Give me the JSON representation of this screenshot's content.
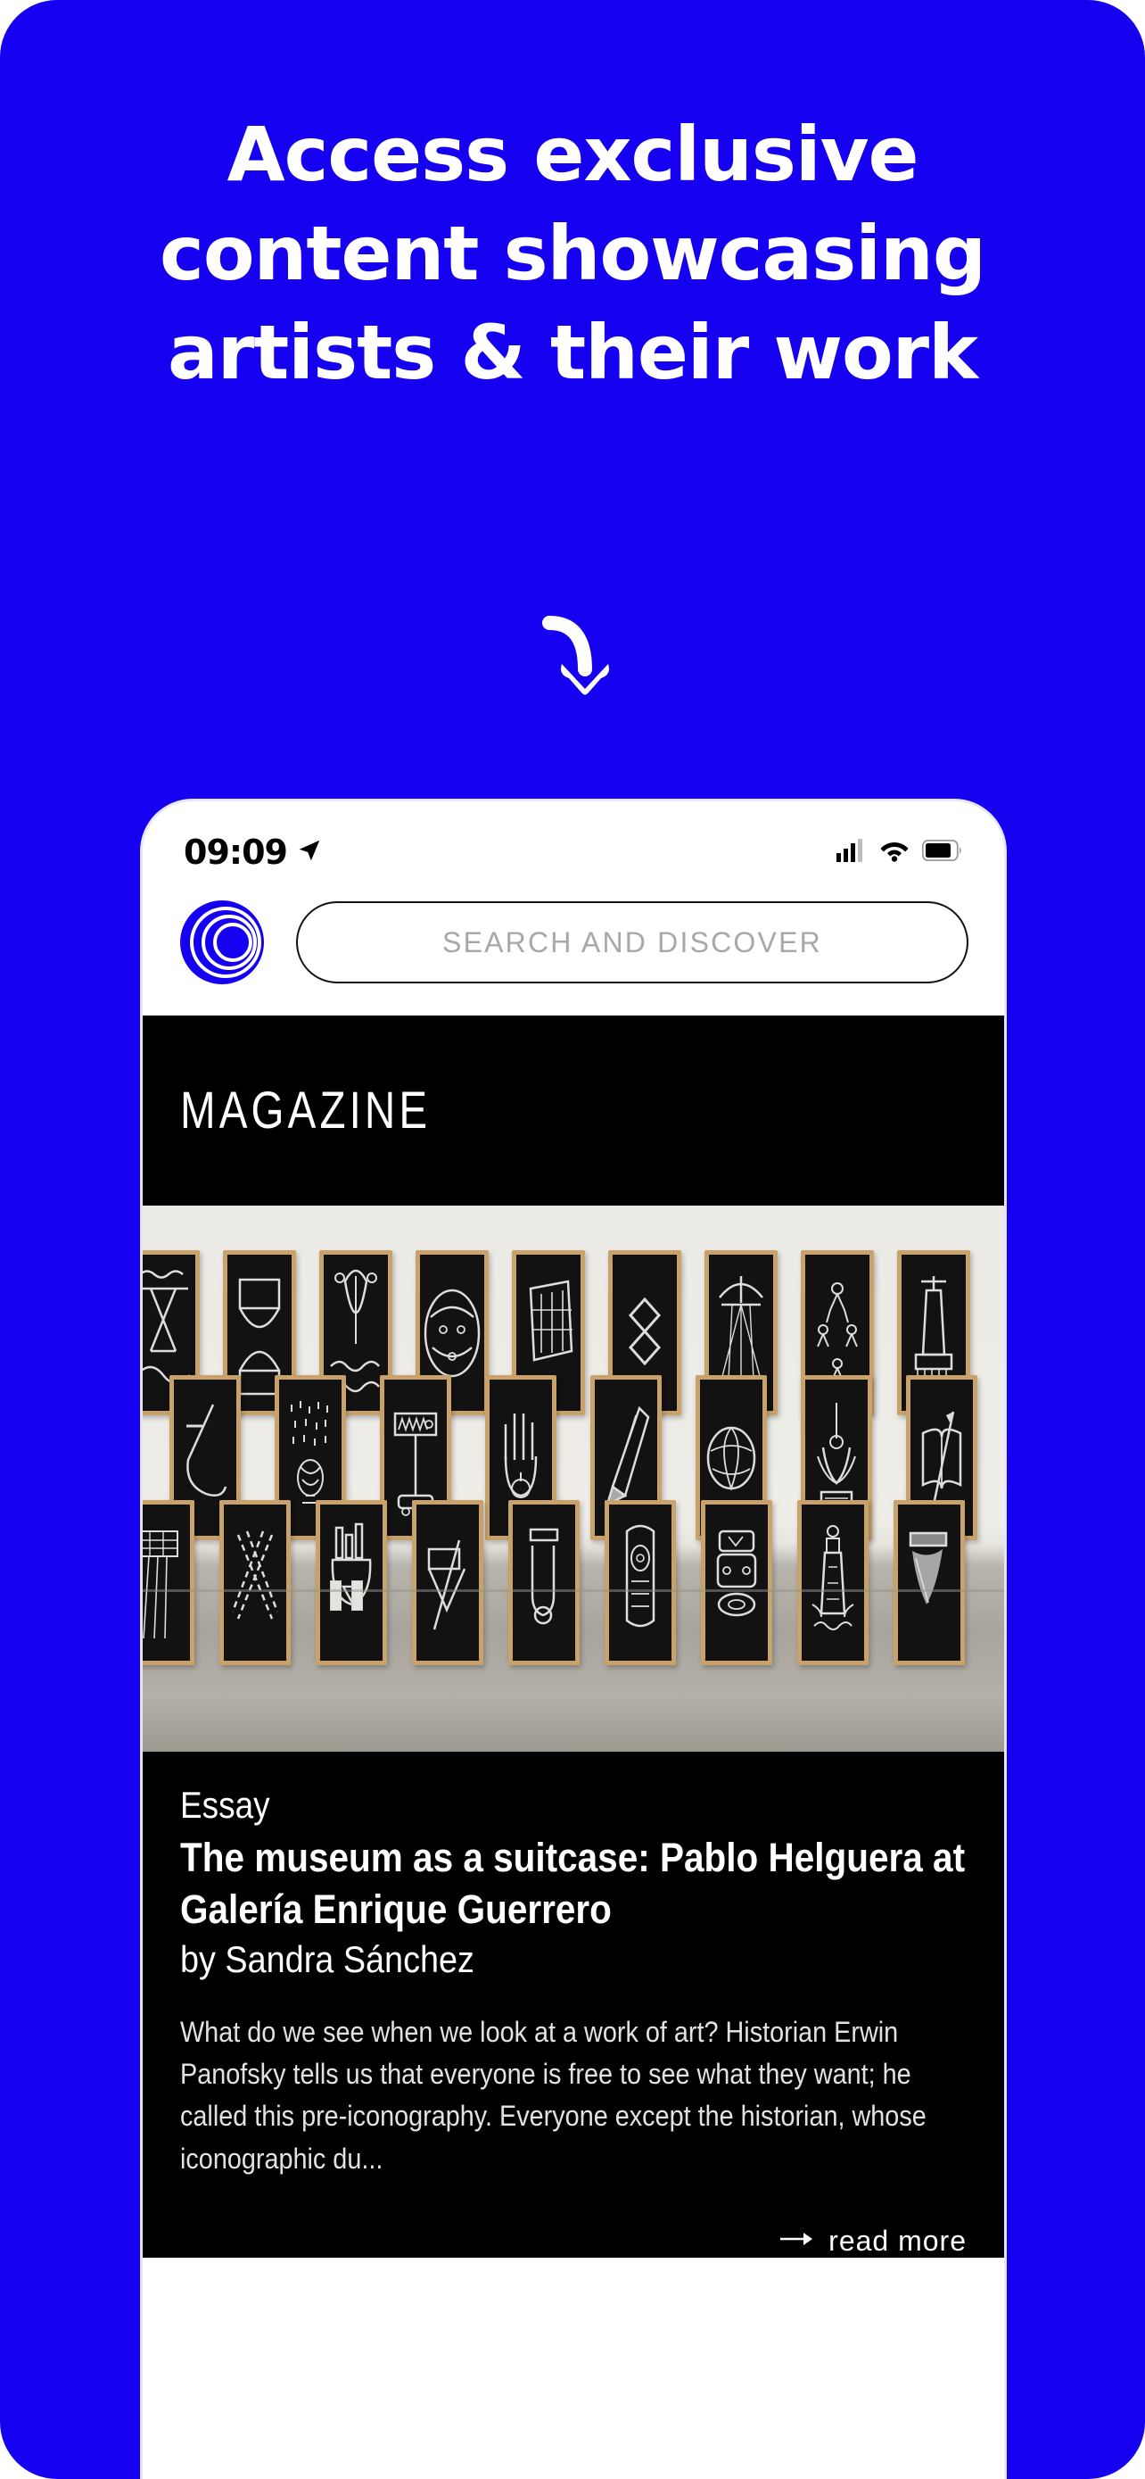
{
  "promo": {
    "background_color": "#1500F0",
    "headline_lines": [
      "Access exclusive",
      "content showcasing",
      "artists & their work"
    ],
    "arrow_icon": "curved-down-arrow-icon"
  },
  "phone": {
    "status_bar": {
      "time": "09:09",
      "location_icon": "location-arrow-icon",
      "signal_icon": "cellular-signal-icon",
      "wifi_icon": "wifi-icon",
      "battery_icon": "battery-full-icon"
    },
    "app_header": {
      "logo_icon": "concentric-circles-logo",
      "logo_color": "#1500F0",
      "search_placeholder": "SEARCH AND DISCOVER",
      "search_value": ""
    },
    "banner": {
      "title": "MAGAZINE",
      "background_color": "#000000",
      "text_color": "#FFFFFF"
    },
    "hero_image": {
      "alt": "gallery-wall-with-framed-chalk-drawings",
      "rows": 3,
      "frames_per_row": [
        9,
        8,
        9
      ]
    },
    "article": {
      "category": "Essay",
      "title": "The museum as a suitcase: Pablo Helguera at Galería Enrique Guerrero",
      "author": "by Sandra Sánchez",
      "excerpt": "What do we see when we look at a work of art? Historian Erwin Panofsky tells us that everyone is free to see what they want; he called this pre-iconography. Everyone except the historian, whose iconographic du...",
      "read_more_label": "read more",
      "read_more_icon": "arrow-right-icon",
      "background_color": "#000000"
    }
  }
}
